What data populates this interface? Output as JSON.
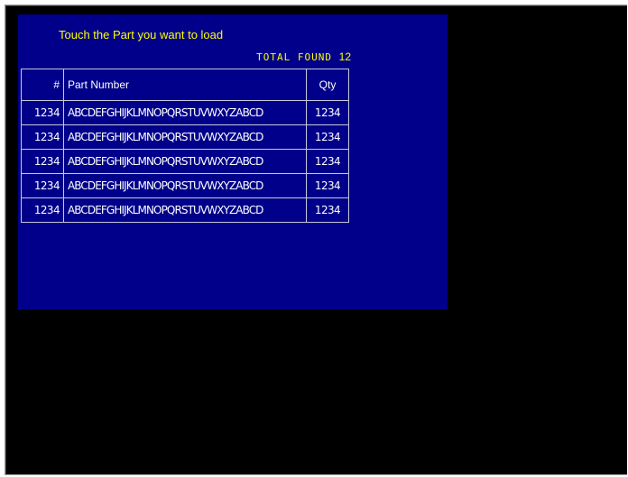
{
  "screen": {
    "instruction": "Touch the Part you want to load",
    "total_found_label": "TOTAL FOUND",
    "total_found_count": "12"
  },
  "table": {
    "headers": {
      "index": "#",
      "part_number": "Part Number",
      "qty": "Qty"
    },
    "rows": [
      {
        "index": "1234",
        "part_number": "ABCDEFGHIJKLMNOPQRSTUVWXYZABCD",
        "qty": "1234"
      },
      {
        "index": "1234",
        "part_number": "ABCDEFGHIJKLMNOPQRSTUVWXYZABCD",
        "qty": "1234"
      },
      {
        "index": "1234",
        "part_number": "ABCDEFGHIJKLMNOPQRSTUVWXYZABCD",
        "qty": "1234"
      },
      {
        "index": "1234",
        "part_number": "ABCDEFGHIJKLMNOPQRSTUVWXYZABCD",
        "qty": "1234"
      },
      {
        "index": "1234",
        "part_number": "ABCDEFGHIJKLMNOPQRSTUVWXYZABCD",
        "qty": "1234"
      }
    ]
  },
  "colors": {
    "panel_background": "#00008a",
    "screen_background": "#000000",
    "accent_text": "#ffff00",
    "table_text": "#ffffff"
  }
}
